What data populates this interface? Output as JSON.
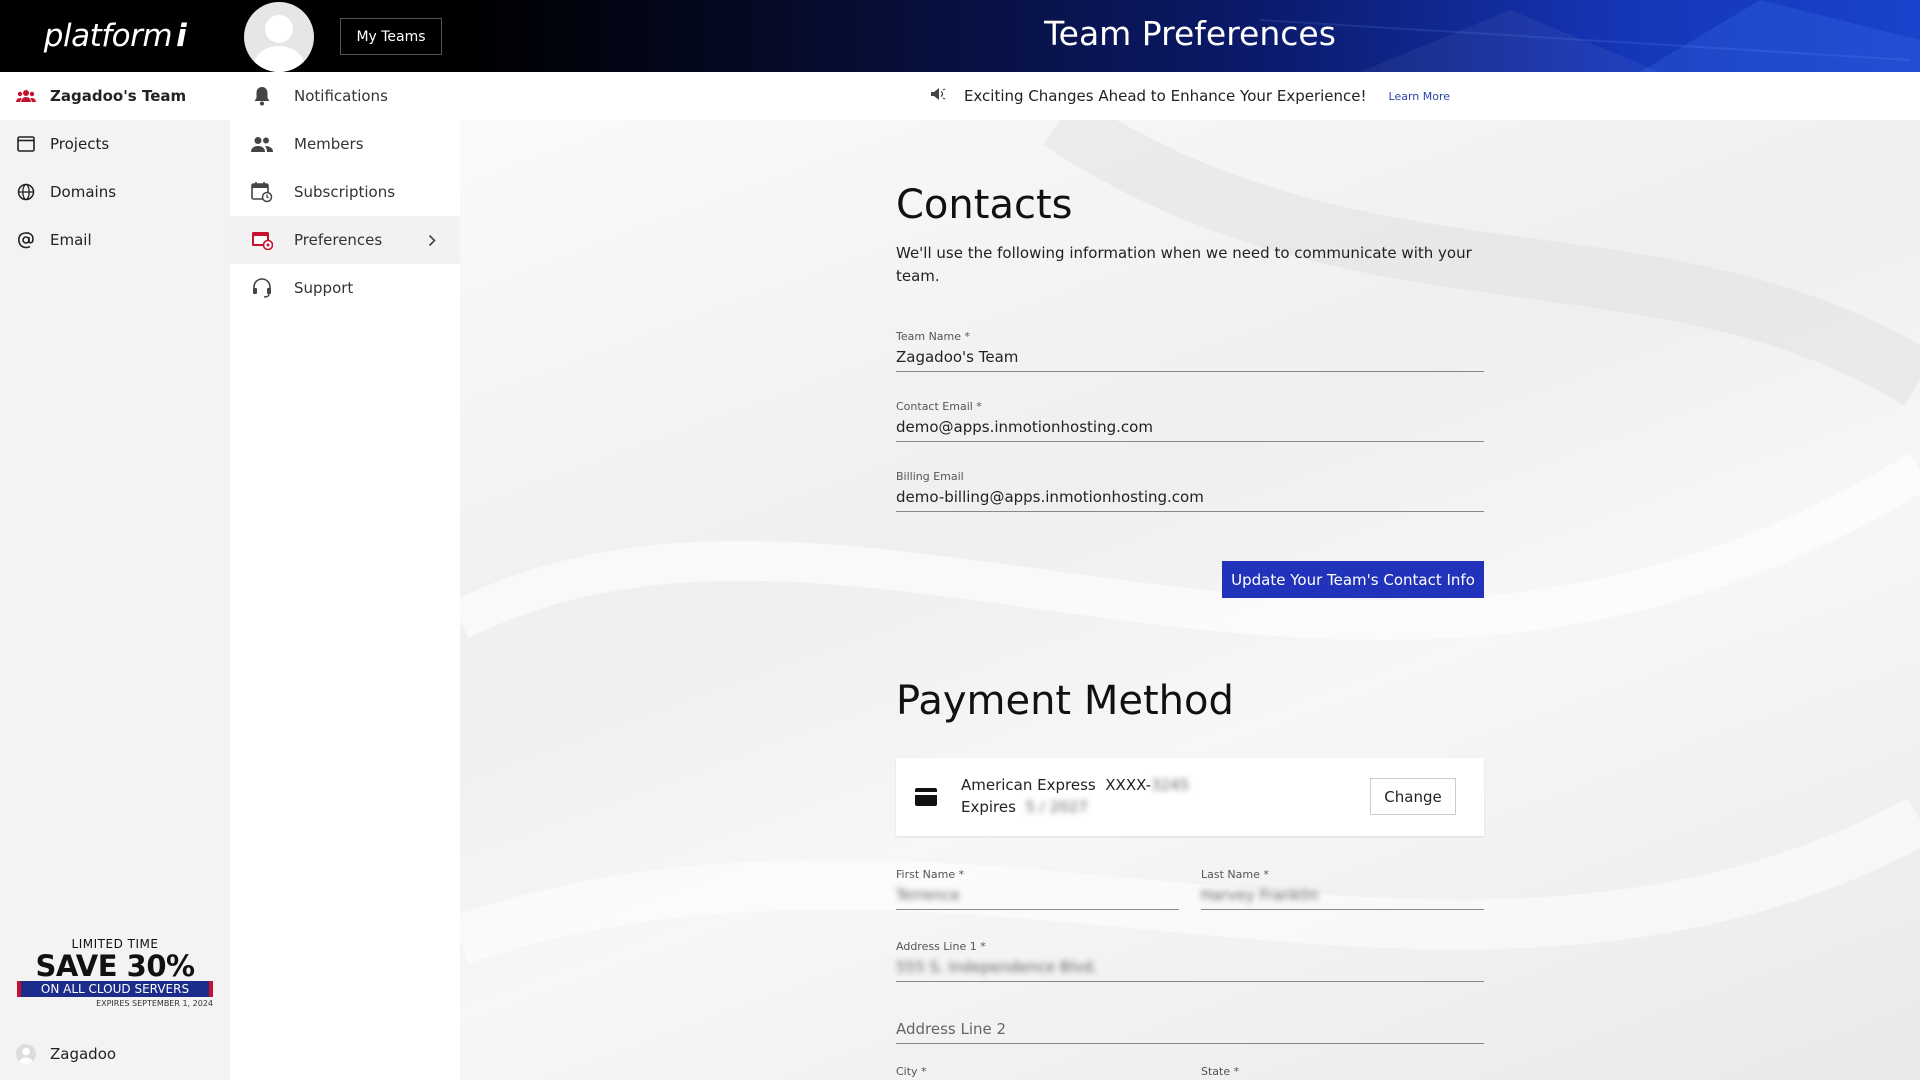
{
  "brand": {
    "logo_text": "platform",
    "logo_i": "i"
  },
  "leftnav": {
    "items": [
      {
        "label": "Zagadoo's Team",
        "icon": "team-icon"
      },
      {
        "label": "Projects",
        "icon": "window-icon"
      },
      {
        "label": "Domains",
        "icon": "globe-icon"
      },
      {
        "label": "Email",
        "icon": "at-icon"
      }
    ],
    "promo": {
      "limited": "LIMITED TIME",
      "save": "SAVE 30%",
      "bar": "ON ALL CLOUD SERVERS",
      "expires": "EXPIRES SEPTEMBER 1, 2024"
    },
    "user_name": "Zagadoo"
  },
  "subnav": {
    "my_teams": "My Teams",
    "items": [
      {
        "label": "Notifications",
        "icon": "bell-icon"
      },
      {
        "label": "Members",
        "icon": "people-icon"
      },
      {
        "label": "Subscriptions",
        "icon": "calendar-icon"
      },
      {
        "label": "Preferences",
        "icon": "preferences-icon"
      },
      {
        "label": "Support",
        "icon": "headset-icon"
      }
    ]
  },
  "header": {
    "title": "Team Preferences"
  },
  "announcement": {
    "text": "Exciting Changes Ahead to Enhance Your Experience!",
    "link": "Learn More"
  },
  "contacts": {
    "title": "Contacts",
    "description": "We'll use the following information when we need to communicate with your team.",
    "team_name_label": "Team Name *",
    "team_name": "Zagadoo's Team",
    "contact_email_label": "Contact Email *",
    "contact_email": "demo@apps.inmotionhosting.com",
    "billing_email_label": "Billing Email",
    "billing_email": "demo-billing@apps.inmotionhosting.com",
    "update_button": "Update Your Team's Contact Info"
  },
  "payment": {
    "title": "Payment Method",
    "card_brand": "American Express",
    "card_mask": "XXXX-",
    "card_last4": "3245",
    "expires_label": "Expires",
    "expires_value": "5 / 2027",
    "change_button": "Change",
    "first_name_label": "First Name *",
    "first_name": "Terrence",
    "last_name_label": "Last Name *",
    "last_name": "Harvey Franklin",
    "address1_label": "Address Line 1 *",
    "address1": "555 S. Independence Blvd.",
    "address2_placeholder": "Address Line 2",
    "city_label": "City *",
    "state_label": "State *"
  },
  "colors": {
    "accent_blue": "#2233bb",
    "brand_red": "#c4122f",
    "header_dark": "#000000"
  }
}
